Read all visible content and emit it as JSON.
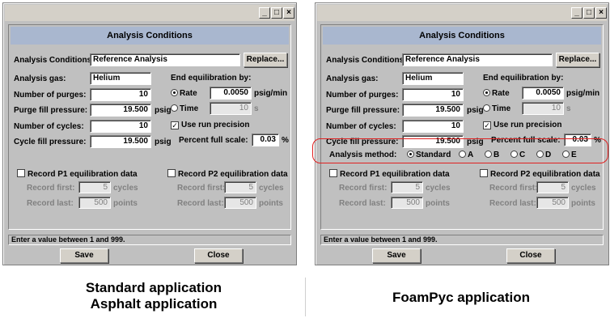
{
  "window": {
    "title_buttons": {
      "minimize": "_",
      "maximize": "□",
      "close": "×"
    },
    "header": "Analysis Conditions",
    "analysis_conditions_label": "Analysis Conditions",
    "analysis_conditions_value": "Reference Analysis",
    "replace_button": "Replace...",
    "analysis_gas_label": "Analysis gas:",
    "analysis_gas_value": "Helium",
    "purges_label": "Number of purges:",
    "purges_value": "10",
    "purge_fill_label": "Purge fill pressure:",
    "purge_fill_value": "19.500",
    "cycles_label": "Number of cycles:",
    "cycles_value": "10",
    "cycle_fill_label": "Cycle fill pressure:",
    "cycle_fill_value": "19.500",
    "psig": "psig",
    "end_eq_label": "End equilibration by:",
    "rate_label": "Rate",
    "rate_value": "0.0050",
    "rate_unit": "psig/min",
    "time_label": "Time",
    "time_value": "10",
    "time_unit": "s",
    "use_run_precision": "Use run precision",
    "percent_full_scale_label": "Percent full scale:",
    "percent_full_scale_value": "0.03",
    "percent_unit": "%",
    "record_p1": "Record P1 equilibration data",
    "record_p2": "Record P2 equilibration data",
    "record_first_label": "Record first:",
    "record_first_value": "5",
    "cycles_unit": "cycles",
    "record_last_label": "Record last:",
    "record_last_value": "500",
    "points_unit": "points",
    "status_text": "Enter a value between 1 and 999.",
    "save_button": "Save",
    "close_button": "Close"
  },
  "foampyc": {
    "analysis_method_label": "Analysis method:",
    "methods": [
      "Standard",
      "A",
      "B",
      "C",
      "D",
      "E"
    ],
    "selected_method": "Standard"
  },
  "captions": {
    "left_line1": "Standard application",
    "left_line2": "Asphalt application",
    "right": "FoamPyc application"
  },
  "colors": {
    "header_bg": "#a9b7cf",
    "dialog_bg": "#c0c0c0",
    "highlight": "#e02020"
  }
}
